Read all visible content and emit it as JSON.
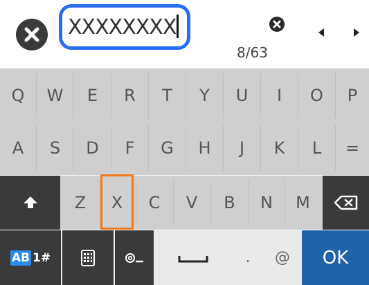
{
  "input": {
    "value": "XXXXXXXX",
    "counter": "8/63"
  },
  "rows": {
    "row1": [
      "Q",
      "W",
      "E",
      "R",
      "T",
      "Y",
      "U",
      "I",
      "O",
      "P"
    ],
    "row2": [
      "A",
      "S",
      "D",
      "F",
      "G",
      "H",
      "J",
      "K",
      "L",
      "="
    ],
    "row3": [
      "Z",
      "X",
      "C",
      "V",
      "B",
      "N",
      "M"
    ]
  },
  "bottom": {
    "ab_label": "AB",
    "num_label": "1#",
    "at_label": "@",
    "dot_label": ".",
    "ok_label": "OK"
  },
  "icons": {
    "close": "close-circle-icon",
    "clear": "clear-circle-icon",
    "left": "arrow-left-icon",
    "right": "arrow-right-icon",
    "shift": "shift-up-icon",
    "backspace": "backspace-icon",
    "keypad": "keypad-icon",
    "email_domain": "email-domain-icon",
    "space": "space-icon"
  },
  "colors": {
    "input_border": "#2a6ef0",
    "selected_key": "#f07a1a",
    "ok_key": "#1f63a8",
    "mode_badge": "#2a8ef0"
  }
}
